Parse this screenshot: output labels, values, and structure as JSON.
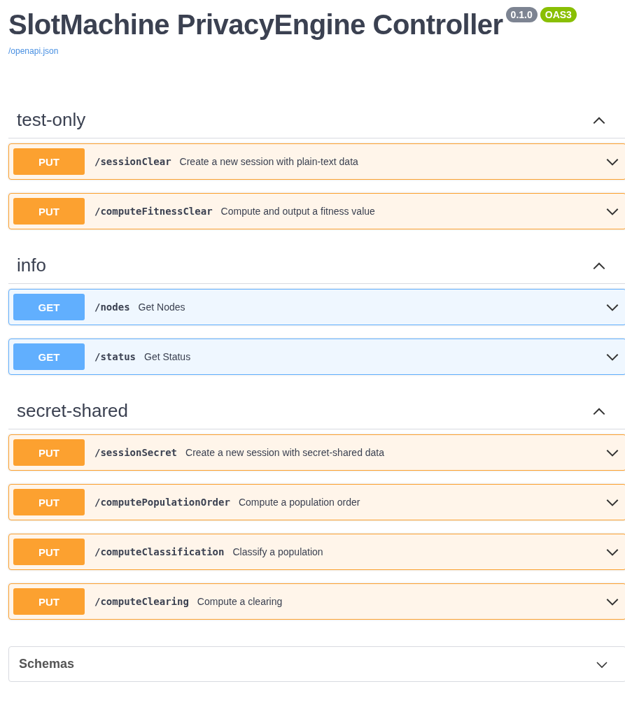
{
  "info": {
    "title": "SlotMachine PrivacyEngine Controller",
    "version": "0.1.0",
    "spec": "OAS3",
    "link": "/openapi.json"
  },
  "tags": [
    {
      "name": "test-only",
      "expanded": true,
      "operations": [
        {
          "method": "PUT",
          "kind": "put",
          "path": "/sessionClear",
          "summary": "Create a new session with plain-text data",
          "expanded": false
        },
        {
          "method": "PUT",
          "kind": "put",
          "path": "/computeFitnessClear",
          "summary": "Compute and output a fitness value",
          "expanded": false
        }
      ]
    },
    {
      "name": "info",
      "expanded": true,
      "operations": [
        {
          "method": "GET",
          "kind": "get",
          "path": "/nodes",
          "summary": "Get Nodes",
          "expanded": false
        },
        {
          "method": "GET",
          "kind": "get",
          "path": "/status",
          "summary": "Get Status",
          "expanded": false
        }
      ]
    },
    {
      "name": "secret-shared",
      "expanded": true,
      "operations": [
        {
          "method": "PUT",
          "kind": "put",
          "path": "/sessionSecret",
          "summary": "Create a new session with secret-shared data",
          "expanded": false
        },
        {
          "method": "PUT",
          "kind": "put",
          "path": "/computePopulationOrder",
          "summary": "Compute a population order",
          "expanded": false
        },
        {
          "method": "PUT",
          "kind": "put",
          "path": "/computeClassification",
          "summary": "Classify a population",
          "expanded": false
        },
        {
          "method": "PUT",
          "kind": "put",
          "path": "/computeClearing",
          "summary": "Compute a clearing",
          "expanded": false
        }
      ]
    }
  ],
  "schemas": {
    "label": "Schemas",
    "expanded": false
  }
}
